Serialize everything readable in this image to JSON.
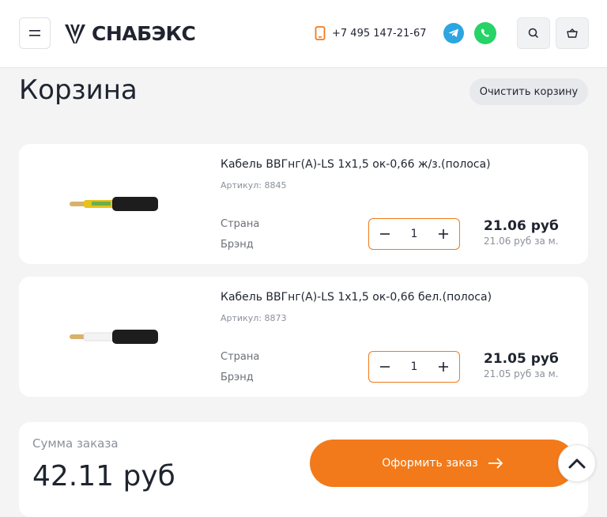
{
  "header": {
    "logo_text": "СНАБЭКС",
    "phone": "+7 495 147-21-67"
  },
  "page": {
    "title": "Корзина",
    "clear_label": "Очистить корзину"
  },
  "cart": {
    "items": [
      {
        "name": "Кабель ВВГнг(А)-LS 1х1,5 ок-0,66 ж/з.(полоса)",
        "sku": "Артикул: 8845",
        "country_label": "Страна",
        "brand_label": "Брэнд",
        "quantity": "1",
        "price": "21.06 руб",
        "unit_price": "21.06 руб за м."
      },
      {
        "name": "Кабель ВВГнг(А)-LS 1х1,5 ок-0,66 бел.(полоса)",
        "sku": "Артикул: 8873",
        "country_label": "Страна",
        "brand_label": "Брэнд",
        "quantity": "1",
        "price": "21.05 руб",
        "unit_price": "21.05 руб за м."
      }
    ]
  },
  "summary": {
    "label": "Сумма заказа",
    "total": "42.11 руб",
    "checkout_label": "Оформить заказ"
  },
  "colors": {
    "accent": "#f27a1a",
    "telegram": "#2ca5e0",
    "whatsapp": "#25d366"
  }
}
